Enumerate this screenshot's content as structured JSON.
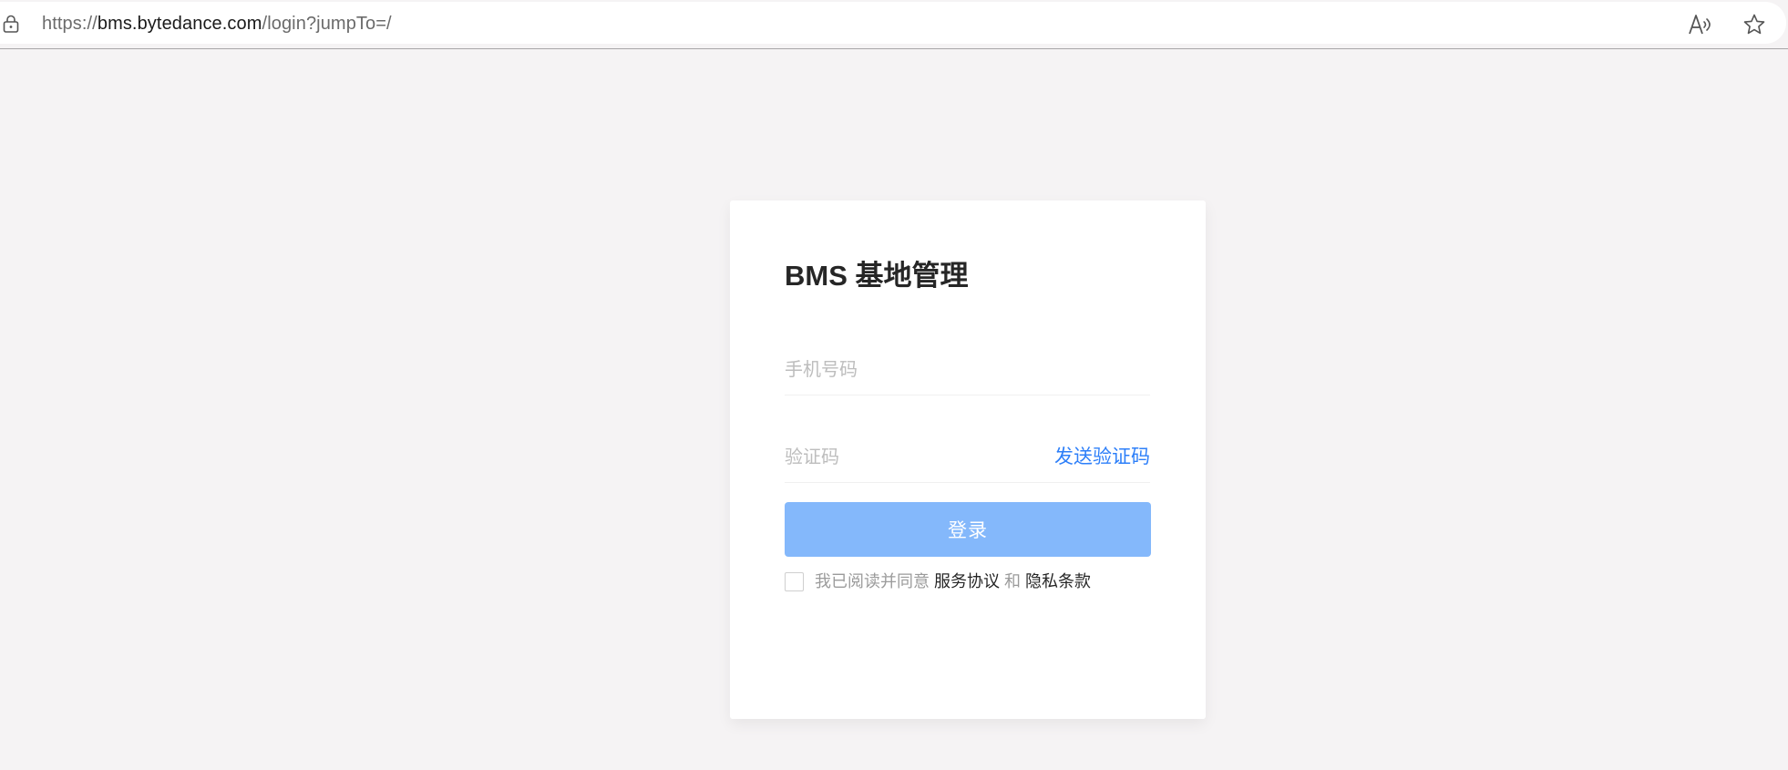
{
  "browser": {
    "url_prefix": "https://",
    "url_host": "bms.bytedance.com",
    "url_path": "/login?jumpTo=/",
    "icons": {
      "lock": "lock-icon",
      "read_aloud": "read-aloud-icon",
      "favorite": "star-icon"
    }
  },
  "login": {
    "title": "BMS 基地管理",
    "phone_placeholder": "手机号码",
    "code_placeholder": "验证码",
    "send_code_label": "发送验证码",
    "submit_label": "登录",
    "agreement": {
      "prefix": "我已阅读并同意",
      "service_link": "服务协议",
      "conjunction": "和",
      "privacy_link": "隐私条款",
      "checked": false
    }
  },
  "colors": {
    "page_background": "#f5f3f4",
    "accent": "#2d7ff9",
    "button_disabled": "#84b8fb"
  }
}
